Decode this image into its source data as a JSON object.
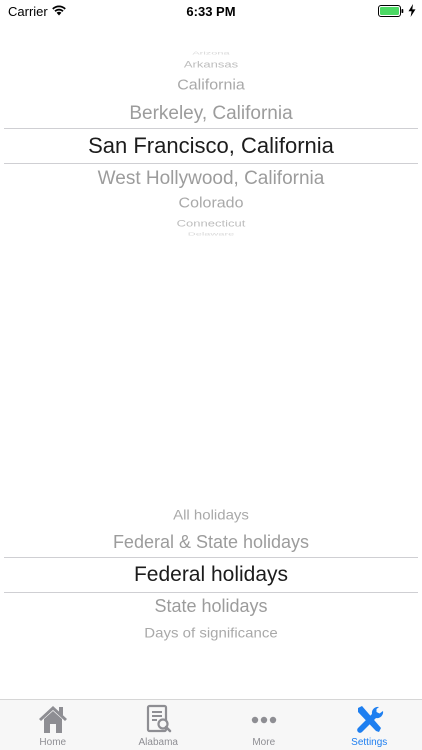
{
  "status_bar": {
    "carrier": "Carrier",
    "time": "6:33 PM",
    "battery_color": "#4cd964"
  },
  "location_picker": {
    "options": [
      "Arizona",
      "Arkansas",
      "California",
      "Berkeley, California",
      "San Francisco, California",
      "West Hollywood, California",
      "Colorado",
      "Connecticut",
      "Delaware"
    ],
    "selected": "San Francisco, California"
  },
  "holiday_picker": {
    "options": [
      "All holidays",
      "Federal & State holidays",
      "Federal holidays",
      "State holidays",
      "Days of significance"
    ],
    "selected": "Federal holidays"
  },
  "tab_bar": {
    "accent_color": "#1e7ff0",
    "inactive_color": "#8e8e93",
    "tabs": [
      {
        "label": "Home",
        "icon": "house-icon"
      },
      {
        "label": "Alabama",
        "icon": "document-search-icon"
      },
      {
        "label": "More",
        "icon": "more-dots-icon"
      },
      {
        "label": "Settings",
        "icon": "tools-icon",
        "active": true
      }
    ]
  }
}
